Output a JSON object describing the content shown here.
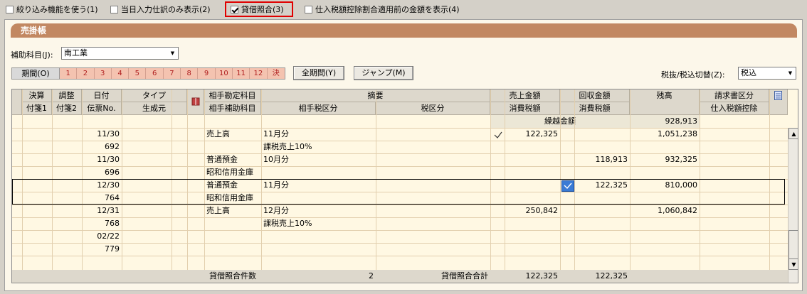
{
  "toolbar": {
    "items": [
      {
        "label": "絞り込み機能を使う(1)",
        "checked": false
      },
      {
        "label": "当日入力仕訳のみ表示(2)",
        "checked": false
      },
      {
        "label": "貸借照合(3)",
        "checked": true
      },
      {
        "label": "仕入税額控除割合適用前の金額を表示(4)",
        "checked": false
      }
    ]
  },
  "panel": {
    "title": "売掛帳",
    "aux_label": "補助科目(J):",
    "aux_value": "南工業",
    "period_label": "期間(O)",
    "months": [
      "1",
      "2",
      "3",
      "4",
      "5",
      "6",
      "7",
      "8",
      "9",
      "10",
      "11",
      "12",
      "決"
    ],
    "all_period_button": "全期間(Y)",
    "jump_button": "ジャンプ(M)",
    "tax_label": "税抜/税込切替(Z):",
    "tax_value": "税込"
  },
  "grid": {
    "headers_top": [
      "決算",
      "調整",
      "日付",
      "タイプ",
      "",
      "相手勘定科目",
      "摘要",
      "",
      "売上金額",
      "回収金額",
      "残高",
      "請求書区分"
    ],
    "headers_bottom": [
      "付箋1",
      "付箋2",
      "伝票No.",
      "生成元",
      "",
      "相手補助科目",
      "相手税区分",
      "税区分",
      "消費税額",
      "消費税額",
      "",
      "仕入税額控除"
    ],
    "carry_label": "繰越金額",
    "carry_value": "928,913",
    "rows": [
      {
        "date": "11/30",
        "no": "692",
        "account": "売上高",
        "sub": "",
        "memo": "11月分",
        "taxcat": "課税売上10%",
        "sales": "122,325",
        "collect": "",
        "balance": "1,051,238",
        "check": "sales"
      },
      {
        "date": "11/30",
        "no": "696",
        "account": "普通預金",
        "sub": "昭和信用金庫",
        "memo": "10月分",
        "taxcat": "",
        "sales": "",
        "collect": "118,913",
        "balance": "932,325",
        "check": ""
      },
      {
        "date": "12/30",
        "no": "764",
        "account": "普通預金",
        "sub": "昭和信用金庫",
        "memo": "11月分",
        "taxcat": "",
        "sales": "",
        "collect": "122,325",
        "balance": "810,000",
        "check": "collect"
      },
      {
        "date": "12/31",
        "no": "768",
        "account": "売上高",
        "sub": "",
        "memo": "12月分",
        "taxcat": "課税売上10%",
        "sales": "250,842",
        "collect": "",
        "balance": "1,060,842",
        "check": ""
      },
      {
        "date": "02/22",
        "no": "779",
        "account": "",
        "sub": "",
        "memo": "",
        "taxcat": "",
        "sales": "",
        "collect": "",
        "balance": "",
        "check": ""
      }
    ],
    "footer": {
      "count_label": "貸借照合件数",
      "count_value": "2",
      "total_label": "貸借照合合計",
      "sales_total": "122,325",
      "collect_total": "122,325"
    }
  },
  "colors": {
    "title_bar": "#c28862",
    "panel_bg": "#fcf7ea",
    "highlight_border": "#e00000",
    "month_bg": "#f4c3b0",
    "selected_check": "#3a7bd5"
  }
}
